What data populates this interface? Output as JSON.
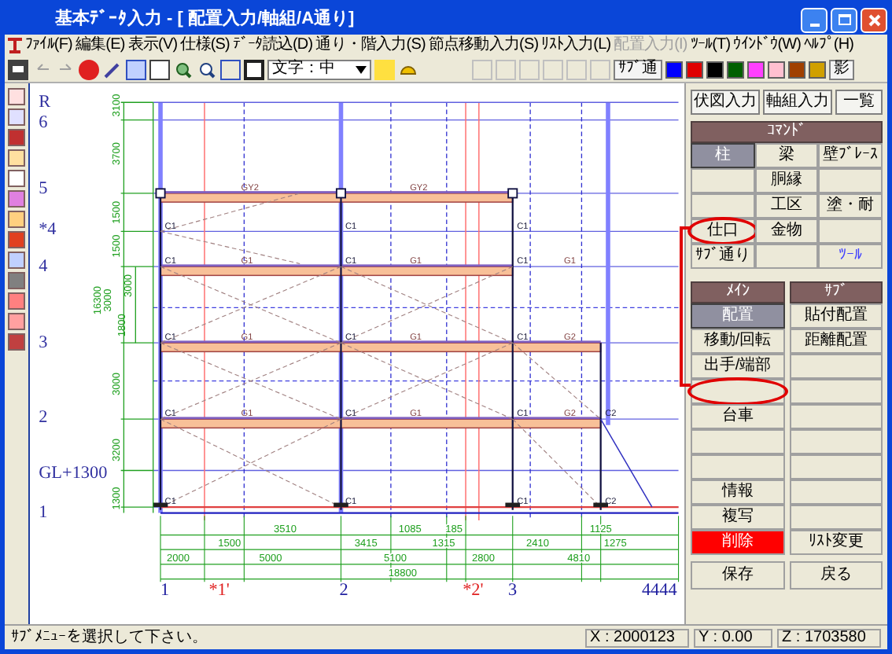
{
  "window": {
    "title": "基本ﾃﾞｰﾀ入力 - [ 配置入力/軸組/A通り]"
  },
  "menu": [
    {
      "label": "ﾌｧｲﾙ(F)",
      "disabled": false
    },
    {
      "label": "編集(E)",
      "disabled": false
    },
    {
      "label": "表示(V)",
      "disabled": false
    },
    {
      "label": "仕様(S)",
      "disabled": false
    },
    {
      "label": "ﾃﾞｰﾀ読込(D)",
      "disabled": false
    },
    {
      "label": "通り・階入力(S)",
      "disabled": false
    },
    {
      "label": "節点移動入力(S)",
      "disabled": false
    },
    {
      "label": "ﾘｽﾄ入力(L)",
      "disabled": false
    },
    {
      "label": "配置入力(I)",
      "disabled": true
    },
    {
      "label": "ﾂｰﾙ(T)",
      "disabled": false
    },
    {
      "label": "ｳｲﾝﾄﾞｳ(W)",
      "disabled": false
    },
    {
      "label": "ﾍﾙﾌﾟ(H)",
      "disabled": false
    }
  ],
  "toolbar": {
    "font_select": "文字：中",
    "sub_grid_button": "ｻﾌﾞ通",
    "shadow_button": "影",
    "swatches": [
      {
        "color": "#0000ff"
      },
      {
        "color": "#e00000"
      },
      {
        "color": "#000000"
      },
      {
        "color": "#006000"
      },
      {
        "color": "#ff40ff"
      },
      {
        "color": "#ffc0d0"
      },
      {
        "color": "#a04000"
      },
      {
        "color": "#d0a000"
      }
    ]
  },
  "top_buttons": [
    "伏図入力",
    "軸組入力",
    "一覧"
  ],
  "command": {
    "title": "ｺﾏﾝﾄﾞ",
    "buttons": [
      {
        "kind": "normal",
        "label": "柱",
        "selected": true,
        "circled": false
      },
      {
        "kind": "normal",
        "label": "梁",
        "selected": false,
        "circled": false
      },
      {
        "kind": "normal",
        "label": "壁ﾌﾞﾚｰｽ",
        "selected": false,
        "circled": false
      },
      {
        "kind": "blank",
        "selected": false,
        "circled": false
      },
      {
        "kind": "normal",
        "label": "胴縁",
        "selected": false,
        "circled": false
      },
      {
        "kind": "blank",
        "selected": false,
        "circled": false
      },
      {
        "kind": "blank",
        "selected": false,
        "circled": false
      },
      {
        "kind": "normal",
        "label": "工区",
        "selected": false,
        "circled": false
      },
      {
        "kind": "normal",
        "label": "塗・耐",
        "selected": false,
        "circled": false
      },
      {
        "kind": "normal",
        "label": "仕口",
        "selected": false,
        "circled": true
      },
      {
        "kind": "normal",
        "label": "金物",
        "selected": false,
        "circled": false
      },
      {
        "kind": "blank",
        "selected": false,
        "circled": false
      },
      {
        "kind": "normal",
        "label": "ｻﾌﾞ通り",
        "selected": false,
        "circled": false
      },
      {
        "kind": "blank",
        "selected": false,
        "circled": false
      },
      {
        "kind": "tool",
        "label": "ﾂｰﾙ",
        "selected": false,
        "circled": false
      }
    ]
  },
  "main": {
    "title": "ﾒｲﾝ",
    "buttons": [
      {
        "kind": "normal",
        "label": "配置",
        "selected": true,
        "circled": false
      },
      {
        "kind": "normal",
        "label": "移動/回転",
        "selected": false,
        "circled": false
      },
      {
        "kind": "normal",
        "label": "出手/端部",
        "selected": false,
        "circled": false
      },
      {
        "kind": "blank",
        "selected": false,
        "circled": true
      },
      {
        "kind": "normal",
        "label": "台車",
        "selected": false,
        "circled": false
      },
      {
        "kind": "blank",
        "selected": false,
        "circled": false
      },
      {
        "kind": "blank",
        "selected": false,
        "circled": false
      },
      {
        "kind": "normal",
        "label": "情報",
        "selected": false,
        "circled": false
      },
      {
        "kind": "normal",
        "label": "複写",
        "selected": false,
        "circled": false
      },
      {
        "kind": "danger",
        "label": "削除",
        "selected": false,
        "circled": false
      }
    ]
  },
  "sub": {
    "title": "ｻﾌﾞ",
    "buttons": [
      {
        "kind": "normal",
        "label": "貼付配置",
        "selected": false,
        "circled": false
      },
      {
        "kind": "normal",
        "label": "距離配置",
        "selected": false,
        "circled": false
      },
      {
        "kind": "blank",
        "selected": false,
        "circled": false
      },
      {
        "kind": "blank",
        "selected": false,
        "circled": false
      },
      {
        "kind": "blank",
        "selected": false,
        "circled": false
      },
      {
        "kind": "blank",
        "selected": false,
        "circled": false
      },
      {
        "kind": "blank",
        "selected": false,
        "circled": false
      },
      {
        "kind": "blank",
        "selected": false,
        "circled": false
      },
      {
        "kind": "blank",
        "selected": false,
        "circled": false
      },
      {
        "kind": "normal",
        "label": "ﾘｽﾄ変更",
        "selected": false,
        "circled": false
      }
    ]
  },
  "bottom_buttons": [
    "保存",
    "戻る"
  ],
  "drawing": {
    "levels": [
      {
        "label": "R"
      },
      {
        "label": "6"
      },
      {
        "label": "5"
      },
      {
        "label": "*4"
      },
      {
        "label": "4"
      },
      {
        "label": "3"
      },
      {
        "label": "2"
      },
      {
        "label": "GL+1300"
      },
      {
        "label": "1"
      }
    ],
    "axes": [
      {
        "label": "1",
        "color": "#2020a0"
      },
      {
        "label": "*1'",
        "color": "#e02020"
      },
      {
        "label": "2",
        "color": "#2020a0"
      },
      {
        "label": "*2'",
        "color": "#e02020"
      },
      {
        "label": "3",
        "color": "#2020a0"
      },
      {
        "label": "4444",
        "color": "#2020a0"
      }
    ],
    "floors": [
      {
        "beam_labels": [
          "GY2",
          "GY2"
        ]
      },
      {
        "column_labels": [
          "C1",
          "C1",
          "C1"
        ]
      },
      {
        "column_labels": [
          "C1",
          "C1",
          "C1"
        ],
        "beam_labels": [
          "G1",
          "G1",
          "G1"
        ]
      },
      {
        "column_labels": [
          "C1",
          "C1",
          "C1"
        ],
        "beam_labels": [
          "G1",
          "G1",
          "G2"
        ]
      },
      {
        "column_labels": [
          "C1",
          "C1",
          "C1",
          "C2"
        ],
        "beam_labels": [
          "G1",
          "G1",
          "G2"
        ]
      },
      {
        "column_labels": [
          "C1",
          "C1",
          "C1",
          "C2"
        ]
      }
    ],
    "vertical_dimensions": [
      "3100",
      "3700",
      "1500",
      "1500",
      "16300",
      "3000",
      "3000",
      "1800",
      "3000",
      "3200",
      "1300"
    ],
    "dimension_row_1": [
      "3510",
      "1085",
      "185",
      "1125"
    ],
    "dimension_row_2": [
      "1500",
      "3415",
      "1315",
      "2410",
      "1275"
    ],
    "dimension_row_3": [
      "2000",
      "5000",
      "5100",
      "2800",
      "4810"
    ],
    "total_dimension": "18800"
  },
  "status_bar": {
    "message": "ｻﾌﾞﾒﾆｭｰを選択して下さい。",
    "x": "X : 2000123",
    "y": "Y : 0.00",
    "z": "Z : 1703580"
  }
}
